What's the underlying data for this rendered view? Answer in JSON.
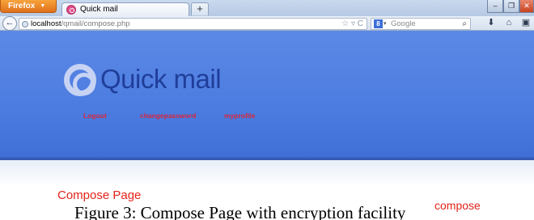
{
  "browser": {
    "menu_button": "Firefox",
    "tab_title": "Quick mail",
    "new_tab": "+",
    "url_host": "localhost",
    "url_path": "/qmail/compose.php",
    "search_placeholder": "Google",
    "window_controls": {
      "minimize": "–",
      "maximize": "❐",
      "close": "✕"
    }
  },
  "site": {
    "logo_text": "Quick mail",
    "nav": [
      {
        "label": "Logout"
      },
      {
        "label": "changepassword"
      },
      {
        "label": "myprofile"
      }
    ]
  },
  "main": {
    "page_title": "Compose Page",
    "side_label": "compose"
  },
  "caption": "Figure 3: Compose Page with encryption facility",
  "colors": {
    "header_blue": "#4c7ce0",
    "link_red": "#d8263a",
    "title_red": "#e2231a",
    "logo_text": "#1f3e9a"
  },
  "icons": {
    "back": "arrow-left-icon",
    "site": "globe-icon",
    "bookmark": "star-icon",
    "reload": "reload-icon",
    "search_engine": "google-icon",
    "search": "magnifier-icon",
    "download": "download-icon",
    "home": "home-icon",
    "addon": "addon-bar-icon"
  }
}
